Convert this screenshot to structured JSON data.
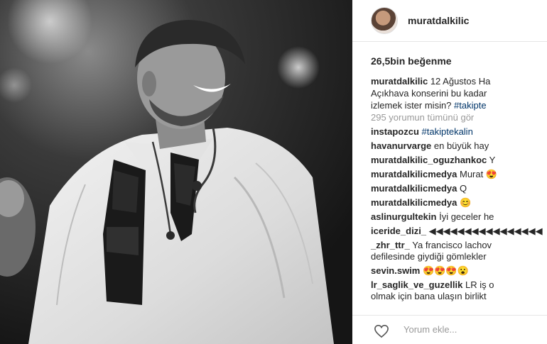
{
  "post": {
    "username": "muratdalkilic",
    "likes": "26,5bin beğenme",
    "caption": {
      "line1_rest": " 12 Ağustos Ha",
      "line2": "Açıkhava konserini bu kadar",
      "line3_text": "izlemek ister misin? ",
      "line3_tag": "#takipte",
      "view_all": "295 yorumun tümünü gör"
    },
    "comments": [
      {
        "user": "instapozcu",
        "text": " ",
        "tag": "#takiptekalin"
      },
      {
        "user": "havanurvarge",
        "text": " en büyük hay"
      },
      {
        "user": "muratdalkilic_oguzhankoc",
        "text": " Y"
      },
      {
        "user": "muratdalkilicmedya",
        "text": " Murat 😍"
      },
      {
        "user": "muratdalkilicmedya",
        "text": " Q"
      },
      {
        "user": "muratdalkilicmedya",
        "text": " 😊"
      },
      {
        "user": "aslinurgultekin",
        "text": " İyi geceler he"
      },
      {
        "user": "iceride_dizi_",
        "text": " ◀◀◀◀◀◀◀◀◀◀◀◀◀◀◀◀"
      },
      {
        "user": "_zhr_ttr_",
        "text": " Ya francisco lachov",
        "line2": "defilesinde giydiği gömlekler"
      },
      {
        "user": "sevin.swim",
        "text": " 😍😍😍😮"
      },
      {
        "user": "lr_saglik_ve_guzellik",
        "text": " LR iş o",
        "line2": "olmak için bana ulaşın birlikt"
      }
    ],
    "add_comment_placeholder": "Yorum ekle...",
    "icons": {
      "avatar": "profile-avatar",
      "heart": "heart-icon"
    }
  }
}
